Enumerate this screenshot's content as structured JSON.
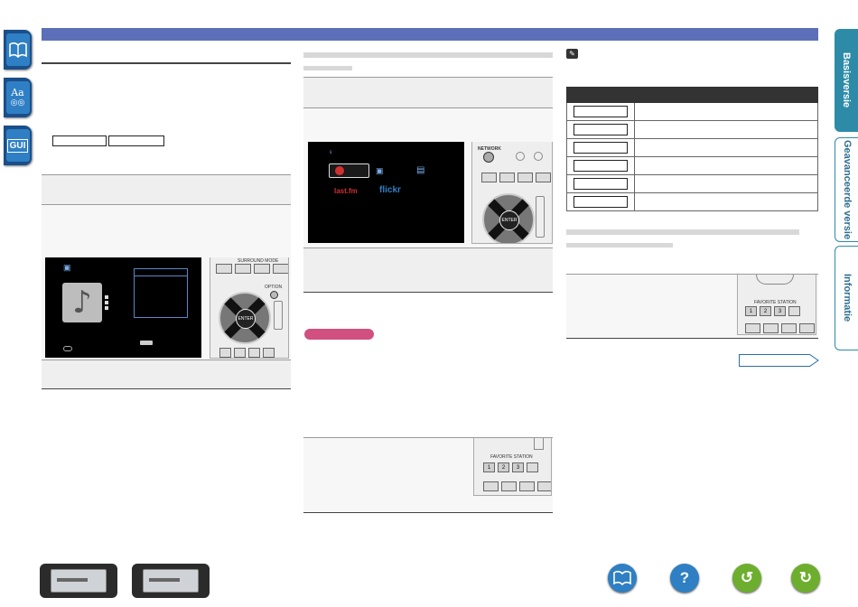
{
  "side_tabs_left": {
    "contents_icon": "book-icon",
    "index_icon": "Aa",
    "gui_label": "GUI"
  },
  "side_tabs_right": [
    "Basisversie",
    "Geavanceerde versie",
    "Informatie"
  ],
  "left_col": {
    "buttons": [
      "",
      ""
    ],
    "screen_rows": 6
  },
  "mid_col": {
    "logos": {
      "lastfm": "last.fm",
      "flickr": "flickr"
    },
    "remote_labels": {
      "network": "NETWORK",
      "option": "OPTION",
      "enter": "ENTER",
      "favorite": "FAVORITE STATION"
    },
    "favorite_buttons": [
      "1",
      "2",
      "3"
    ]
  },
  "right_col": {
    "table_rows": 6,
    "favorite_buttons": [
      "1",
      "2",
      "3"
    ],
    "remote_label": "FAVORITE STATION"
  },
  "bottom_nav": {
    "devices": [
      "receiver-front-icon",
      "receiver-rear-icon"
    ],
    "buttons": [
      {
        "name": "book-icon",
        "color": "#2f7fc4"
      },
      {
        "name": "help-icon",
        "color": "#2f7fc4",
        "glyph": "?"
      },
      {
        "name": "back-icon",
        "color": "#6dae2e",
        "glyph": "↺"
      },
      {
        "name": "forward-icon",
        "color": "#6dae2e",
        "glyph": "↻"
      }
    ]
  },
  "colors": {
    "topbar": "#5c6fb8",
    "tab_blue": "#1a4f8a",
    "accent_teal": "#2d8ba8",
    "pink": "#d1507f"
  }
}
